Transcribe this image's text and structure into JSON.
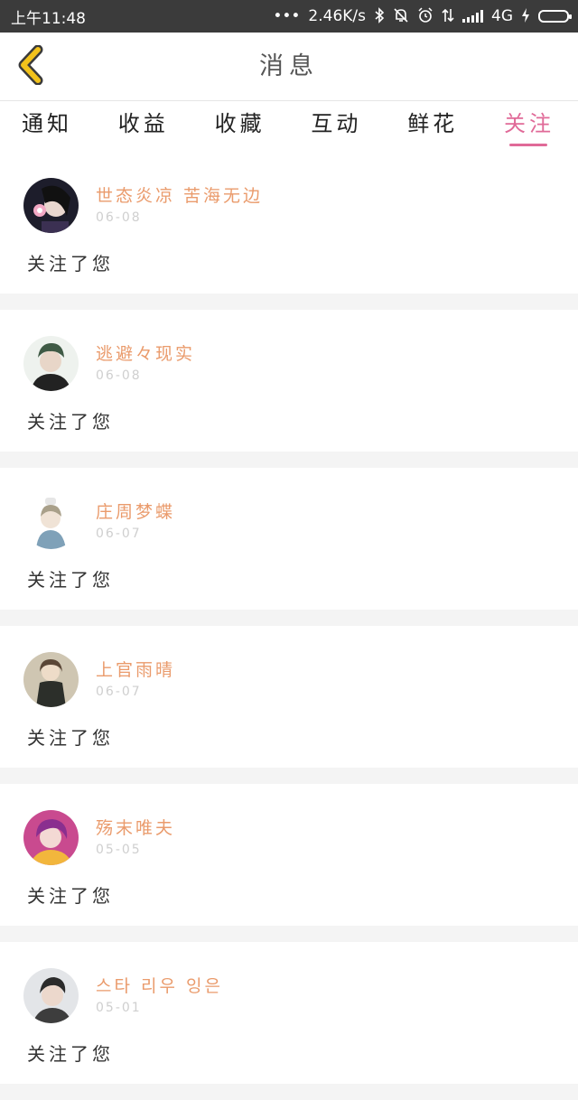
{
  "status_bar": {
    "time": "上午11:48",
    "dots": "•••",
    "speed": "2.46K/s",
    "network": "4G",
    "icons": [
      "bluetooth-icon",
      "mute-bell-icon",
      "alarm-icon",
      "data-arrows-icon",
      "signal-icon",
      "charging-icon",
      "battery-icon"
    ]
  },
  "header": {
    "title": "消息",
    "back_icon": "chevron-left-icon",
    "accent": "#f2c21b"
  },
  "tabs": [
    {
      "label": "通知",
      "active": false
    },
    {
      "label": "收益",
      "active": false
    },
    {
      "label": "收藏",
      "active": false
    },
    {
      "label": "互动",
      "active": false
    },
    {
      "label": "鲜花",
      "active": false
    },
    {
      "label": "关注",
      "active": true
    }
  ],
  "colors": {
    "active_tab": "#e06a98",
    "username": "#ea9b6c",
    "date": "#cfcfcf",
    "divider": "#f4f4f4"
  },
  "items": [
    {
      "name": "世态炎凉 苦海无边",
      "date": "06-08",
      "message": "关注了您"
    },
    {
      "name": "逃避々现实",
      "date": "06-08",
      "message": "关注了您"
    },
    {
      "name": "庄周梦蝶",
      "date": "06-07",
      "message": "关注了您"
    },
    {
      "name": "上官雨晴",
      "date": "06-07",
      "message": "关注了您"
    },
    {
      "name": "殇末唯夫",
      "date": "05-05",
      "message": "关注了您"
    },
    {
      "name": "스타 리우 잉은",
      "date": "05-01",
      "message": "关注了您"
    }
  ]
}
